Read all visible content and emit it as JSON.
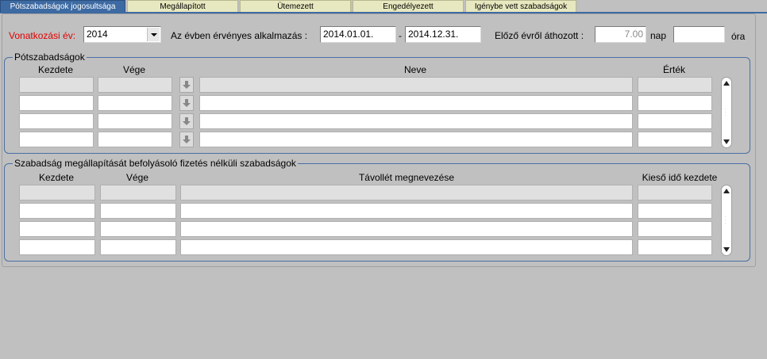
{
  "tabs": [
    {
      "label": "Pótszabadságok jogosultsága",
      "active": true
    },
    {
      "label": "Megállapított",
      "active": false
    },
    {
      "label": "Ütemezett",
      "active": false
    },
    {
      "label": "Engedélyezett",
      "active": false
    },
    {
      "label": "Igénybe vett szabadságok",
      "active": false
    }
  ],
  "header": {
    "year_label": "Vonatkozási év:",
    "year_value": "2014",
    "employment_label": "Az évben érvényes alkalmazás :",
    "date_from": "2014.01.01.",
    "date_sep": "-",
    "date_to": "2014.12.31.",
    "carry_label": "Előző évről áthozott :",
    "carry_days": "7.00",
    "nap_label": "nap",
    "carry_hours": "",
    "ora_label": "óra"
  },
  "extra_leave": {
    "title": "Pótszabadságok",
    "columns": [
      "Kezdete",
      "Vége",
      "Neve",
      "Érték"
    ]
  },
  "unpaid_leave": {
    "title": "Szabadság megállapítását befolyásoló fizetés nélküli szabadságok",
    "columns": [
      "Kezdete",
      "Vége",
      "Távollét megnevezése",
      "Kieső idő kezdete"
    ]
  },
  "colors": {
    "tab_active": "#3d6aa2",
    "group_border": "#4a6fa5",
    "label_red": "#e00000"
  }
}
